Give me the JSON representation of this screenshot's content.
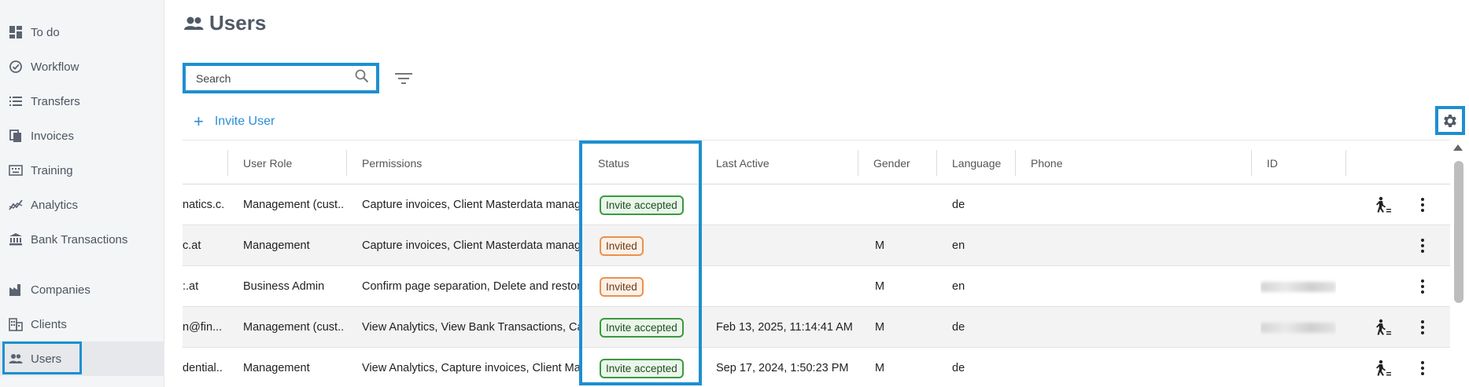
{
  "sidebar": {
    "items": [
      {
        "label": "To do",
        "icon": "dashboard-icon"
      },
      {
        "label": "Workflow",
        "icon": "check-circle-icon"
      },
      {
        "label": "Transfers",
        "icon": "list-icon"
      },
      {
        "label": "Invoices",
        "icon": "documents-icon"
      },
      {
        "label": "Training",
        "icon": "keyboard-icon"
      },
      {
        "label": "Analytics",
        "icon": "analytics-icon"
      },
      {
        "label": "Bank Transactions",
        "icon": "bank-icon"
      },
      {
        "label": "Companies",
        "icon": "factory-icon"
      },
      {
        "label": "Clients",
        "icon": "building-icon"
      },
      {
        "label": "Users",
        "icon": "users-icon"
      }
    ],
    "active": "Users"
  },
  "page": {
    "title": "Users"
  },
  "search": {
    "placeholder": "Search"
  },
  "toolbar": {
    "invite_label": "Invite User"
  },
  "table": {
    "columns": [
      "User Role",
      "Permissions",
      "Status",
      "Last Active",
      "Gender",
      "Language",
      "Phone",
      "ID"
    ],
    "rows": [
      {
        "email": "natics.c...",
        "role": "Management (cust...",
        "permissions": "Capture invoices, Client Masterdata manag...",
        "status": "Invite accepted",
        "last_active": "",
        "gender": "",
        "language": "de",
        "phone": "",
        "has_id": false,
        "has_walk_icon": true
      },
      {
        "email": "c.at",
        "role": "Management",
        "permissions": "Capture invoices, Client Masterdata manag...",
        "status": "Invited",
        "last_active": "",
        "gender": "M",
        "language": "en",
        "phone": "",
        "has_id": false,
        "has_walk_icon": false
      },
      {
        "email": ":.at",
        "role": "Business Admin",
        "permissions": "Confirm page separation, Delete and restor...",
        "status": "Invited",
        "last_active": "",
        "gender": "M",
        "language": "en",
        "phone": "",
        "has_id": true,
        "has_walk_icon": false
      },
      {
        "email": "n@fin...",
        "role": "Management (cust...",
        "permissions": "View Analytics, View Bank Transactions, Ca...",
        "status": "Invite accepted",
        "last_active": "Feb 13, 2025, 11:14:41 AM",
        "gender": "M",
        "language": "de",
        "phone": "",
        "has_id": true,
        "has_walk_icon": true
      },
      {
        "email": "dential...",
        "role": "Management",
        "permissions": "View Analytics, Capture invoices, Client Ma...",
        "status": "Invite accepted",
        "last_active": "Sep 17, 2024, 1:50:23 PM",
        "gender": "M",
        "language": "de",
        "phone": "",
        "has_id": false,
        "has_walk_icon": true
      }
    ]
  },
  "colors": {
    "accent": "#1d8fd1",
    "link": "#2a8fd6",
    "accepted_border": "#3b9a3f",
    "invited_border": "#e8914f"
  }
}
